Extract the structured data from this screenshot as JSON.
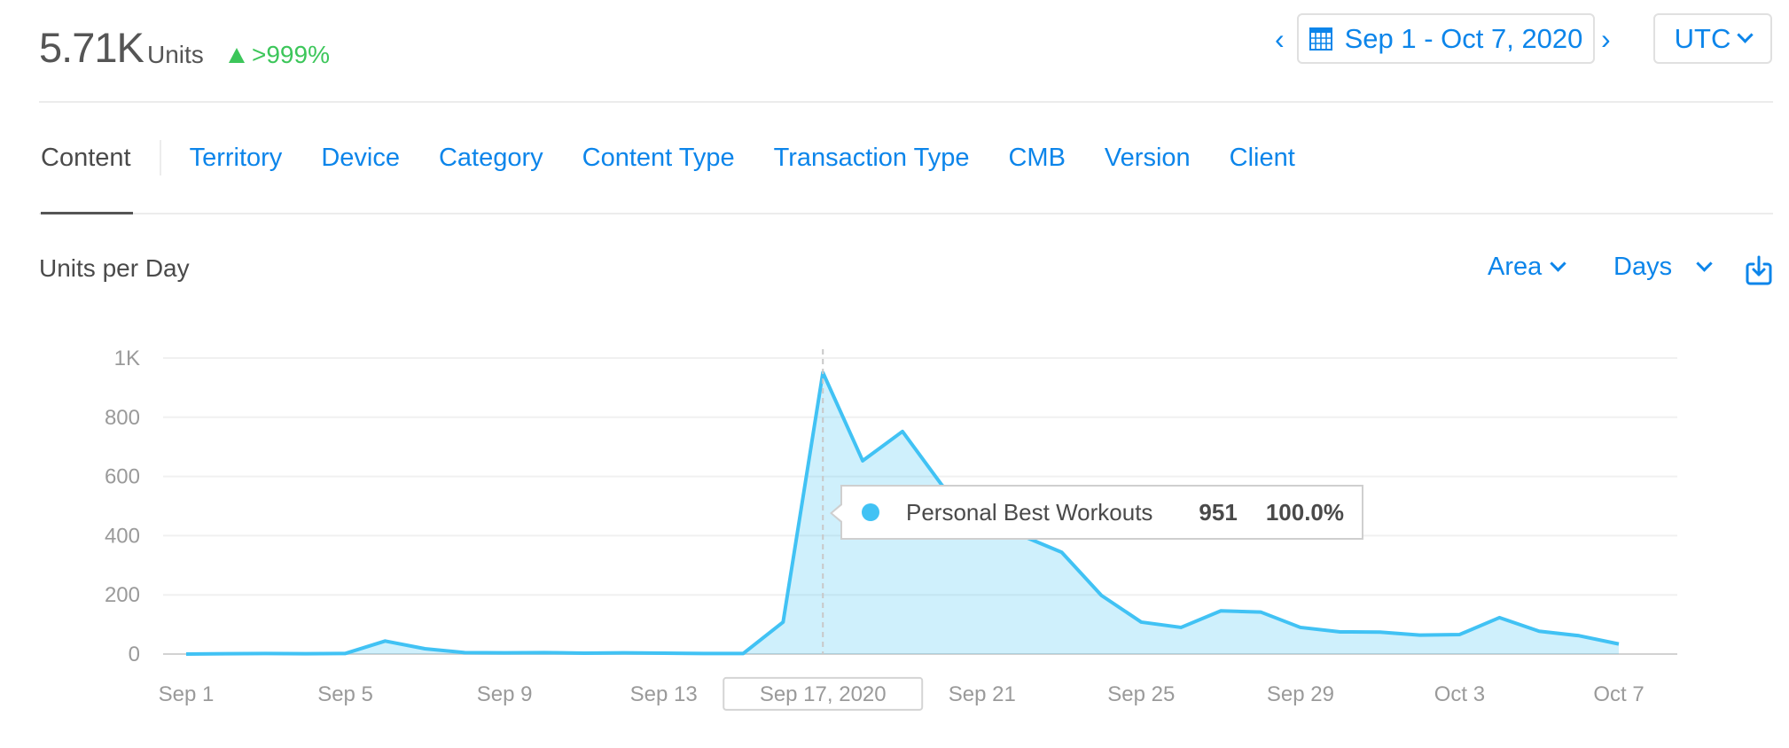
{
  "summary": {
    "total": "5.71K",
    "units_label": "Units",
    "delta": ">999%",
    "delta_color": "#3cc65a"
  },
  "date_range": {
    "label": "Sep 1 - Oct 7, 2020",
    "prev_icon": "chevron-left-icon",
    "next_icon": "chevron-right-icon",
    "calendar_icon": "calendar-icon"
  },
  "timezone": {
    "label": "UTC"
  },
  "tabs": [
    {
      "label": "Content",
      "active": true
    },
    {
      "label": "Territory"
    },
    {
      "label": "Device"
    },
    {
      "label": "Category"
    },
    {
      "label": "Content Type"
    },
    {
      "label": "Transaction Type"
    },
    {
      "label": "CMB"
    },
    {
      "label": "Version"
    },
    {
      "label": "Client"
    }
  ],
  "chart_header": {
    "title": "Units per Day",
    "chart_type_label": "Area",
    "interval_label": "Days",
    "download_icon": "download-icon"
  },
  "accent_color": "#0c85ea",
  "series_color": "#41c2f4",
  "tooltip": {
    "series_name": "Personal Best Workouts",
    "value": "951",
    "percent": "100.0%",
    "date": "Sep 17, 2020"
  },
  "chart_data": {
    "type": "area",
    "title": "Units per Day",
    "xlabel": "",
    "ylabel": "",
    "ylim": [
      0,
      1000
    ],
    "yticks": [
      0,
      200,
      400,
      600,
      800,
      1000
    ],
    "ytick_labels": [
      "0",
      "200",
      "400",
      "600",
      "800",
      "1K"
    ],
    "grid": true,
    "x": [
      "Sep 1",
      "Sep 2",
      "Sep 3",
      "Sep 4",
      "Sep 5",
      "Sep 6",
      "Sep 7",
      "Sep 8",
      "Sep 9",
      "Sep 10",
      "Sep 11",
      "Sep 12",
      "Sep 13",
      "Sep 14",
      "Sep 15",
      "Sep 16",
      "Sep 17",
      "Sep 18",
      "Sep 19",
      "Sep 20",
      "Sep 21",
      "Sep 22",
      "Sep 23",
      "Sep 24",
      "Sep 25",
      "Sep 26",
      "Sep 27",
      "Sep 28",
      "Sep 29",
      "Sep 30",
      "Oct 1",
      "Oct 2",
      "Oct 3",
      "Oct 4",
      "Oct 5",
      "Oct 6",
      "Oct 7"
    ],
    "xtick_labels": [
      "Sep 1",
      "Sep 5",
      "Sep 9",
      "Sep 13",
      "Sep 17, 2020",
      "Sep 21",
      "Sep 25",
      "Sep 29",
      "Oct 3",
      "Oct 7"
    ],
    "xtick_indices": [
      0,
      4,
      8,
      12,
      16,
      20,
      24,
      28,
      32,
      36
    ],
    "highlight_index": 16,
    "series": [
      {
        "name": "Personal Best Workouts",
        "values": [
          0,
          1,
          2,
          1,
          2,
          44,
          18,
          5,
          4,
          5,
          3,
          4,
          3,
          2,
          2,
          108,
          951,
          653,
          752,
          569,
          480,
          400,
          344,
          198,
          108,
          90,
          146,
          142,
          90,
          75,
          74,
          64,
          66,
          123,
          77,
          62,
          34
        ]
      }
    ]
  }
}
